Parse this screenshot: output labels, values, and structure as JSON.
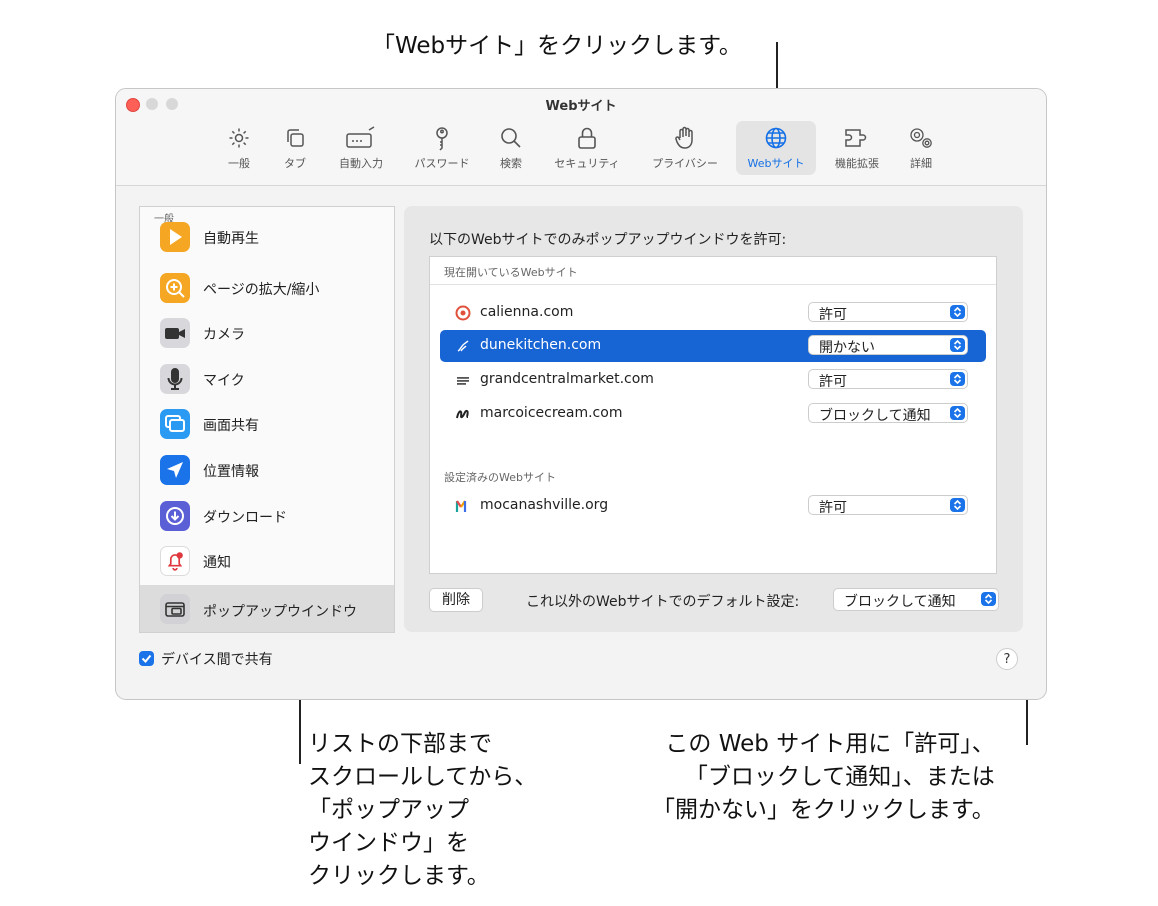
{
  "callouts": {
    "top": "「Webサイト」をクリックします。",
    "bottom_left": "リストの下部まで\nスクロールしてから、\n「ポップアップ\nウインドウ」を\nクリックします。",
    "bottom_right": "この Web サイト用に「許可」、\n「ブロックして通知」、または\n「開かない」をクリックします。"
  },
  "window": {
    "title": "Webサイト"
  },
  "toolbar": {
    "tabs": [
      {
        "label": "一般",
        "icon": "gear-icon"
      },
      {
        "label": "タブ",
        "icon": "tabs-icon"
      },
      {
        "label": "自動入力",
        "icon": "autofill-icon"
      },
      {
        "label": "パスワード",
        "icon": "key-icon"
      },
      {
        "label": "検索",
        "icon": "search-icon"
      },
      {
        "label": "セキュリティ",
        "icon": "lock-icon"
      },
      {
        "label": "プライバシー",
        "icon": "hand-icon"
      },
      {
        "label": "Webサイト",
        "icon": "globe-icon",
        "active": true
      },
      {
        "label": "機能拡張",
        "icon": "extensions-icon"
      },
      {
        "label": "詳細",
        "icon": "gears-icon"
      }
    ]
  },
  "sidebar": {
    "header": "一般",
    "items": [
      {
        "label": "自動再生",
        "icon": "play-icon",
        "color": "#f5a623"
      },
      {
        "label": "ページの拡大/縮小",
        "icon": "zoom-icon",
        "color": "#f5a623"
      },
      {
        "label": "カメラ",
        "icon": "camera-icon",
        "color": "#8e8e93"
      },
      {
        "label": "マイク",
        "icon": "microphone-icon",
        "color": "#8e8e93"
      },
      {
        "label": "画面共有",
        "icon": "screen-share-icon",
        "color": "#2b9af3"
      },
      {
        "label": "位置情報",
        "icon": "location-icon",
        "color": "#1a73e8"
      },
      {
        "label": "ダウンロード",
        "icon": "download-icon",
        "color": "#5b5fd6"
      },
      {
        "label": "通知",
        "icon": "bell-icon",
        "color": "#ffffff"
      },
      {
        "label": "ポップアップウインドウ",
        "icon": "popup-window-icon",
        "color": "#8e8e93",
        "selected": true
      }
    ]
  },
  "main": {
    "title": "以下のWebサイトでのみポップアップウインドウを許可:",
    "current_header": "現在開いているWebサイト",
    "current_sites": [
      {
        "domain": "calienna.com",
        "setting": "許可"
      },
      {
        "domain": "dunekitchen.com",
        "setting": "開かない",
        "selected": true
      },
      {
        "domain": "grandcentralmarket.com",
        "setting": "許可"
      },
      {
        "domain": "marcoicecream.com",
        "setting": "ブロックして通知"
      }
    ],
    "configured_header": "設定済みのWebサイト",
    "configured_sites": [
      {
        "domain": "mocanashville.org",
        "setting": "許可"
      }
    ],
    "remove_button": "削除",
    "default_label": "これ以外のWebサイトでのデフォルト設定:",
    "default_value": "ブロックして通知"
  },
  "footer": {
    "share_label": "デバイス間で共有",
    "share_checked": true,
    "help": "?"
  },
  "colors": {
    "accent": "#1a73e8",
    "selection": "#1764d4"
  }
}
